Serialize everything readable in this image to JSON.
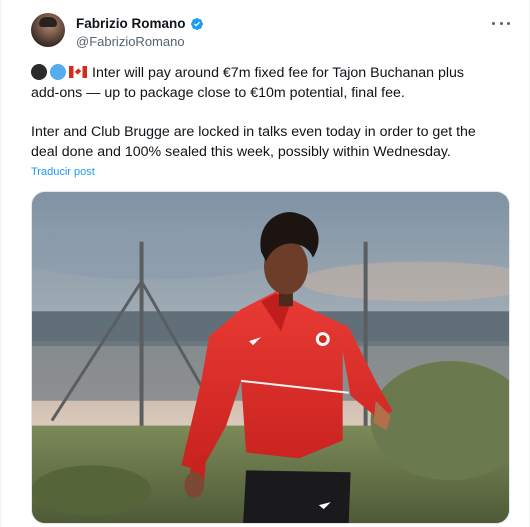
{
  "author": {
    "display_name": "Fabrizio Romano",
    "handle": "@FabrizioRomano",
    "verified": true,
    "avatar_icon": "avatar-photo"
  },
  "tweet": {
    "emojis": [
      "black-circle",
      "blue-circle",
      "canada-flag"
    ],
    "paragraph_1_line_1": "Inter will pay around €7m fixed fee for Tajon Buchanan plus",
    "paragraph_1_line_2": "add-ons — up to package close to €10m potential, final fee.",
    "paragraph_2_line_1": "Inter and Club Brugge are locked in talks even today in order to get the",
    "paragraph_2_line_2": "deal done and 100% sealed this week, possibly within Wednesday.",
    "translate_label": "Traducir post"
  },
  "media": {
    "description_icon": "photo-player-in-red-training-top"
  },
  "colors": {
    "text_primary": "#0f1419",
    "text_secondary": "#536471",
    "link": "#1d9bf0",
    "verified": "#1d9bf0",
    "jersey_red": "#e0302c"
  }
}
